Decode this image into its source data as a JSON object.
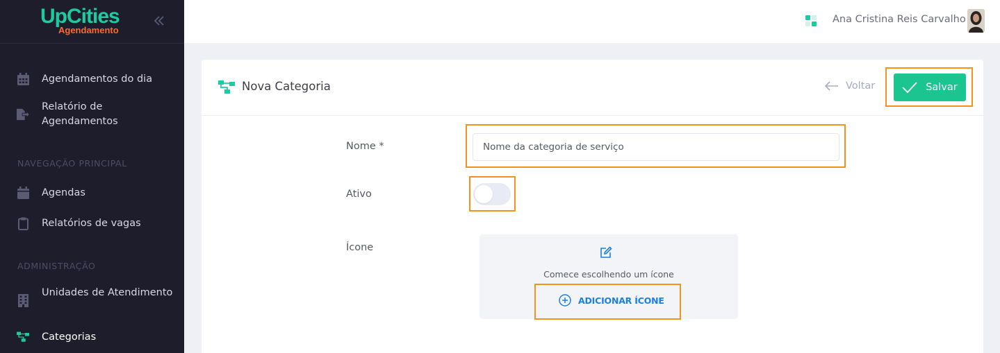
{
  "brand": {
    "name": "UpCities",
    "subtitle": "Agendamento",
    "primary_color": "#1ccba0",
    "accent_color": "#ff6a2a"
  },
  "sidebar": {
    "collapse_icon": "double-chevron-left-icon",
    "items_top": [
      {
        "label": "Agendamentos do dia",
        "icon": "calendar-icon"
      },
      {
        "label": "Relatório de Agendamentos",
        "icon": "file-export-icon"
      }
    ],
    "sections": [
      {
        "title": "NAVEGAÇÃO PRINCIPAL",
        "items": [
          {
            "label": "Agendas",
            "icon": "calendar-icon"
          },
          {
            "label": "Relatórios de vagas",
            "icon": "clipboard-icon"
          }
        ]
      },
      {
        "title": "ADMINISTRAÇÃO",
        "items": [
          {
            "label": "Unidades de Atendimento",
            "icon": "building-icon"
          },
          {
            "label": "Categorias",
            "icon": "sitemap-icon",
            "active": true
          }
        ]
      }
    ]
  },
  "topbar": {
    "user_name": "Ana Cristina Reis Carvalho",
    "apps_icon": "apps-grid-icon"
  },
  "card": {
    "title": "Nova Categoria",
    "back_label": "Voltar",
    "save_label": "Salvar"
  },
  "form": {
    "name_label": "Nome *",
    "name_placeholder": "Nome da categoria de serviço",
    "name_value": "",
    "active_label": "Ativo",
    "active_value": false,
    "icon_label": "Ícone",
    "icon_hint": "Comece escolhendo um ícone",
    "add_icon_label": "ADICIONAR ÍCONE"
  }
}
